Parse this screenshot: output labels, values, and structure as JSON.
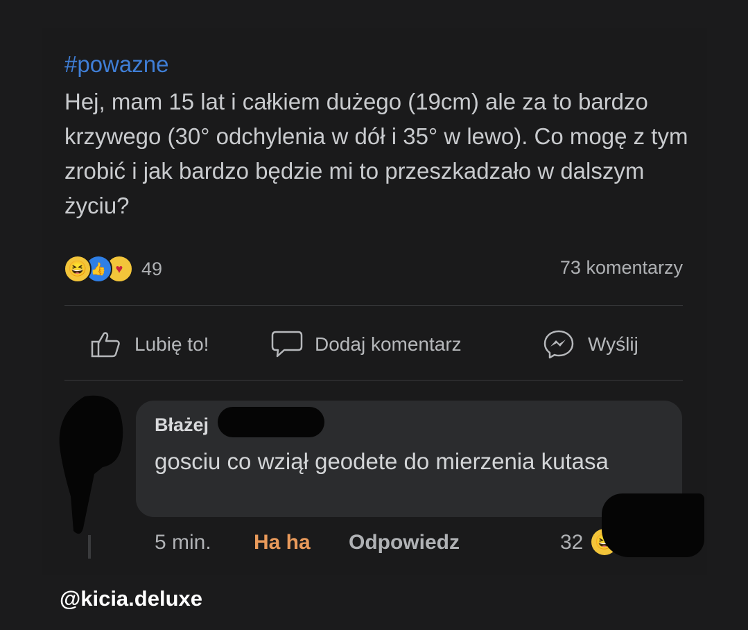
{
  "post": {
    "hashtag": "#powazne",
    "text": "Hej, mam 15 lat i całkiem dużego (19cm) ale za to bardzo krzywego (30° odchylenia w dół i 35° w lewo). Co mogę z tym zrobić i jak bardzo będzie mi to przeszkadzało w dalszym życiu?",
    "reactions": {
      "icons": [
        "haha-icon",
        "like-icon",
        "care-icon"
      ],
      "count": "49"
    },
    "comments_count": "73 komentarzy"
  },
  "actions": {
    "like_label": "Lubię to!",
    "comment_label": "Dodaj komentarz",
    "send_label": "Wyślij"
  },
  "comment": {
    "author": "Błażej",
    "text": "gosciu co wziął geodete do mierzenia kutasa",
    "time": "5 min.",
    "reaction_label": "Ha ha",
    "reply_label": "Odpowiedz",
    "reaction_count": "32"
  },
  "watermark": "@kicia.deluxe",
  "colors": {
    "hashtag": "#3f7ed6",
    "haha_reaction": "#e99a5b",
    "background": "#1a1a1b",
    "bubble": "#2b2c2e"
  }
}
